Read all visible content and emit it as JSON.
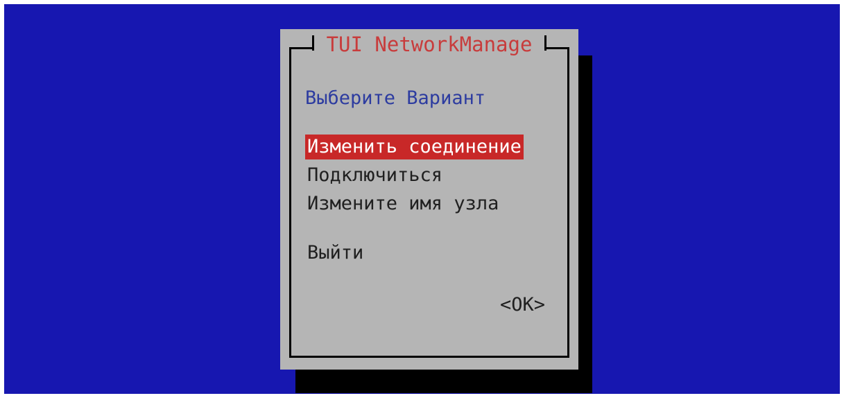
{
  "dialog": {
    "title": "TUI NetworkManage",
    "prompt": "Выберите Вариант",
    "menu_items": [
      {
        "label": "Изменить соединение",
        "selected": true
      },
      {
        "label": "Подключиться",
        "selected": false
      },
      {
        "label": "Измените имя узла",
        "selected": false
      },
      {
        "label": "Выйти",
        "selected": false
      }
    ],
    "ok_label": "<OK>"
  },
  "colors": {
    "screen_background": "#1717b0",
    "dialog_background": "#b5b5b5",
    "title_text": "#c83c3c",
    "prompt_text": "#2d3ca0",
    "selected_background": "#c82828",
    "selected_text": "#ffffff"
  }
}
